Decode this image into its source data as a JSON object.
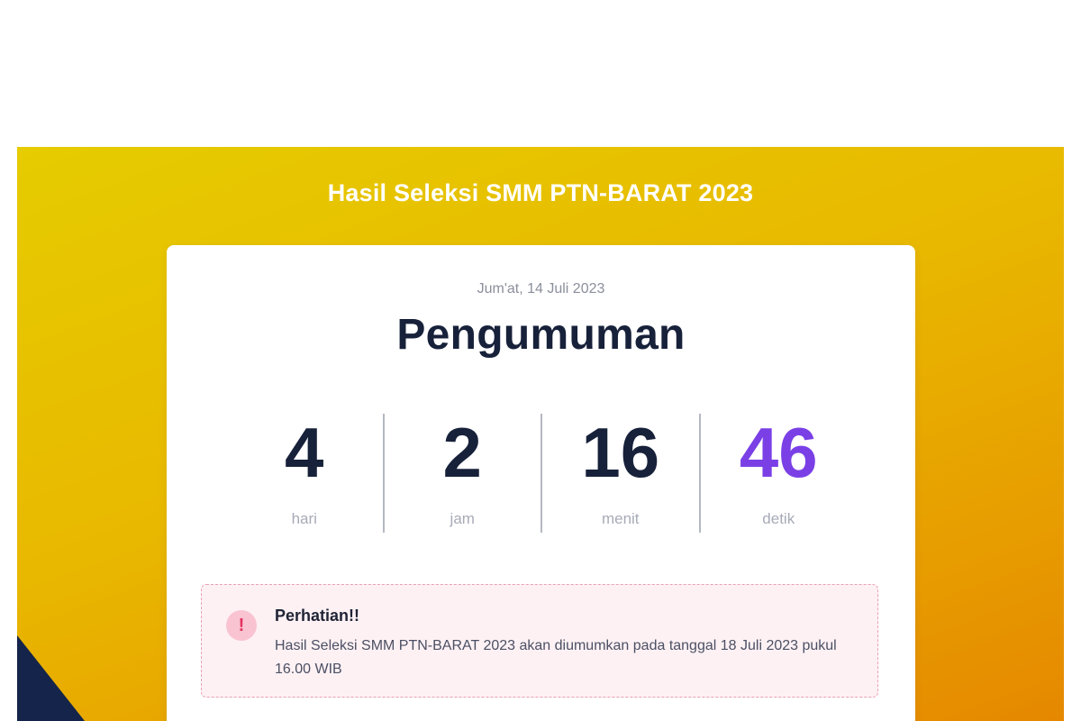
{
  "banner": {
    "title": "Hasil Seleksi SMM PTN-BARAT 2023"
  },
  "card": {
    "date": "Jum'at, 14 Juli 2023",
    "heading": "Pengumuman"
  },
  "countdown": [
    {
      "value": "4",
      "label": "hari"
    },
    {
      "value": "2",
      "label": "jam"
    },
    {
      "value": "16",
      "label": "menit"
    },
    {
      "value": "46",
      "label": "detik"
    }
  ],
  "alert": {
    "icon": "!",
    "title": "Perhatian!!",
    "body": "Hasil Seleksi SMM PTN-BARAT 2023 akan diumumkan pada tanggal 18 Juli 2023 pukul 16.00 WIB"
  },
  "colors": {
    "banner_gradient_start": "#e6cc00",
    "banner_gradient_end": "#e58800",
    "heading_text": "#17213a",
    "seconds_accent": "#7a40e6",
    "alert_background": "#fef1f4",
    "alert_icon": "#e3325e",
    "corner_shape": "#14244a"
  }
}
